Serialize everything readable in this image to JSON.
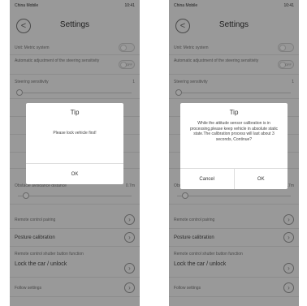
{
  "status_bar": {
    "carrier": "China Mobile",
    "time": "10:41"
  },
  "header": {
    "title": "Settings",
    "back_glyph": "<"
  },
  "settings": {
    "unit": "Unit:  Metric system",
    "auto_adjust": "Automatic adjustment of the steering sensitivity",
    "auto_adjust_state": "OFF",
    "steering": "Steering sensitivity",
    "steering_value": "1",
    "obstacle": "Obstacle avoidance distance",
    "obstacle_value": "0.7m",
    "remote_pairing": "Remote control pairing",
    "posture": "Posture calibration",
    "shutter_fn": "Remote control shutter button function",
    "lock_car": "Lock the car / unlock",
    "follow": "Follow settings"
  },
  "dialog_left": {
    "title": "Tip",
    "message": "Please lock vehicle first!",
    "ok_label": "OK"
  },
  "dialog_right": {
    "title": "Tip",
    "message": "While the attitude sensor calibration is in processing,please keep vehicle in absolute static state.The calibration process will last about 3 seconds, Continue?",
    "cancel_label": "Cancel",
    "ok_label": "OK"
  },
  "icons": {
    "chevron": "chevron-right-icon",
    "back": "back-arrow-icon"
  },
  "colors": {
    "overlay": "#000000",
    "dialog_bg": "#ffffff"
  }
}
